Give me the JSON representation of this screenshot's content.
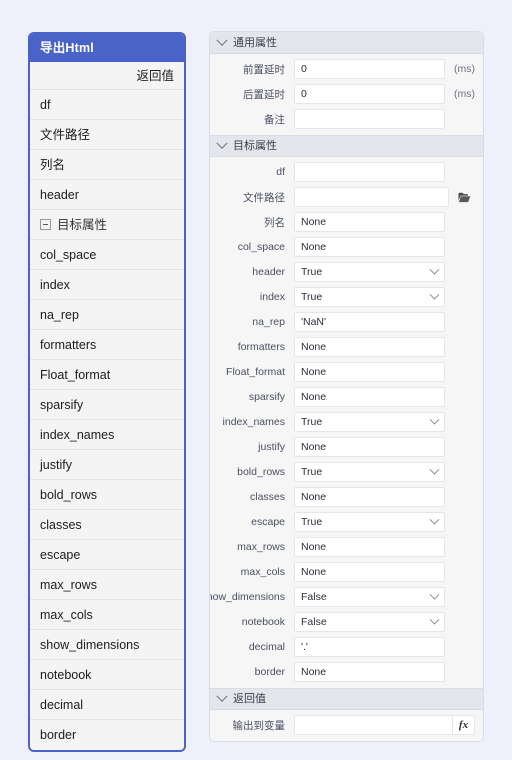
{
  "left_panel": {
    "title": "导出Html",
    "subhead": "返回值",
    "items": [
      {
        "label": "df",
        "group": false
      },
      {
        "label": "文件路径",
        "group": false
      },
      {
        "label": "列名",
        "group": false
      },
      {
        "label": "header",
        "group": false
      },
      {
        "label": "目标属性",
        "group": true
      },
      {
        "label": "col_space",
        "group": false
      },
      {
        "label": "index",
        "group": false
      },
      {
        "label": "na_rep",
        "group": false
      },
      {
        "label": "formatters",
        "group": false
      },
      {
        "label": "Float_format",
        "group": false
      },
      {
        "label": "sparsify",
        "group": false
      },
      {
        "label": "index_names",
        "group": false
      },
      {
        "label": "justify",
        "group": false
      },
      {
        "label": "bold_rows",
        "group": false
      },
      {
        "label": "classes",
        "group": false
      },
      {
        "label": "escape",
        "group": false
      },
      {
        "label": "max_rows",
        "group": false
      },
      {
        "label": "max_cols",
        "group": false
      },
      {
        "label": "show_dimensions",
        "group": false
      },
      {
        "label": "notebook",
        "group": false
      },
      {
        "label": "decimal",
        "group": false
      },
      {
        "label": "border",
        "group": false
      }
    ]
  },
  "right_panel": {
    "sections": [
      {
        "title": "通用属性",
        "rows": [
          {
            "label": "前置延时",
            "value": "0",
            "type": "text",
            "suffix": "(ms)"
          },
          {
            "label": "后置延时",
            "value": "0",
            "type": "text",
            "suffix": "(ms)"
          },
          {
            "label": "备注",
            "value": "",
            "type": "text",
            "suffix": ""
          }
        ]
      },
      {
        "title": "目标属性",
        "rows": [
          {
            "label": "df",
            "value": "",
            "type": "text",
            "suffix": ""
          },
          {
            "label": "文件路径",
            "value": "",
            "type": "text",
            "suffix": "",
            "icon": "folder-icon"
          },
          {
            "label": "列名",
            "value": "None",
            "type": "text",
            "suffix": ""
          },
          {
            "label": "col_space",
            "value": "None",
            "type": "text",
            "suffix": ""
          },
          {
            "label": "header",
            "value": "True",
            "type": "select",
            "suffix": ""
          },
          {
            "label": "index",
            "value": "True",
            "type": "select",
            "suffix": ""
          },
          {
            "label": "na_rep",
            "value": "'NaN'",
            "type": "text",
            "suffix": ""
          },
          {
            "label": "formatters",
            "value": "None",
            "type": "text",
            "suffix": ""
          },
          {
            "label": "Float_format",
            "value": "None",
            "type": "text",
            "suffix": ""
          },
          {
            "label": "sparsify",
            "value": "None",
            "type": "text",
            "suffix": ""
          },
          {
            "label": "index_names",
            "value": "True",
            "type": "select",
            "suffix": ""
          },
          {
            "label": "justify",
            "value": "None",
            "type": "text",
            "suffix": ""
          },
          {
            "label": "bold_rows",
            "value": "True",
            "type": "select",
            "suffix": ""
          },
          {
            "label": "classes",
            "value": "None",
            "type": "text",
            "suffix": ""
          },
          {
            "label": "escape",
            "value": "True",
            "type": "select",
            "suffix": ""
          },
          {
            "label": "max_rows",
            "value": "None",
            "type": "text",
            "suffix": ""
          },
          {
            "label": "max_cols",
            "value": "None",
            "type": "text",
            "suffix": ""
          },
          {
            "label": "show_dimensions",
            "value": "False",
            "type": "select",
            "suffix": ""
          },
          {
            "label": "notebook",
            "value": "False",
            "type": "select",
            "suffix": ""
          },
          {
            "label": "decimal",
            "value": "'.'",
            "type": "text",
            "suffix": ""
          },
          {
            "label": "border",
            "value": "None",
            "type": "text",
            "suffix": ""
          }
        ]
      },
      {
        "title": "返回值",
        "rows": [
          {
            "label": "输出到变量",
            "value": "",
            "type": "text",
            "suffix": "",
            "fx": "fx"
          }
        ]
      }
    ]
  },
  "colors": {
    "page_background": "#eef1fb",
    "accent_header": "#4a63c8",
    "panel_background": "#f6f6f7",
    "section_header": "#e4e6ec",
    "list_background": "#f4f4f4"
  }
}
